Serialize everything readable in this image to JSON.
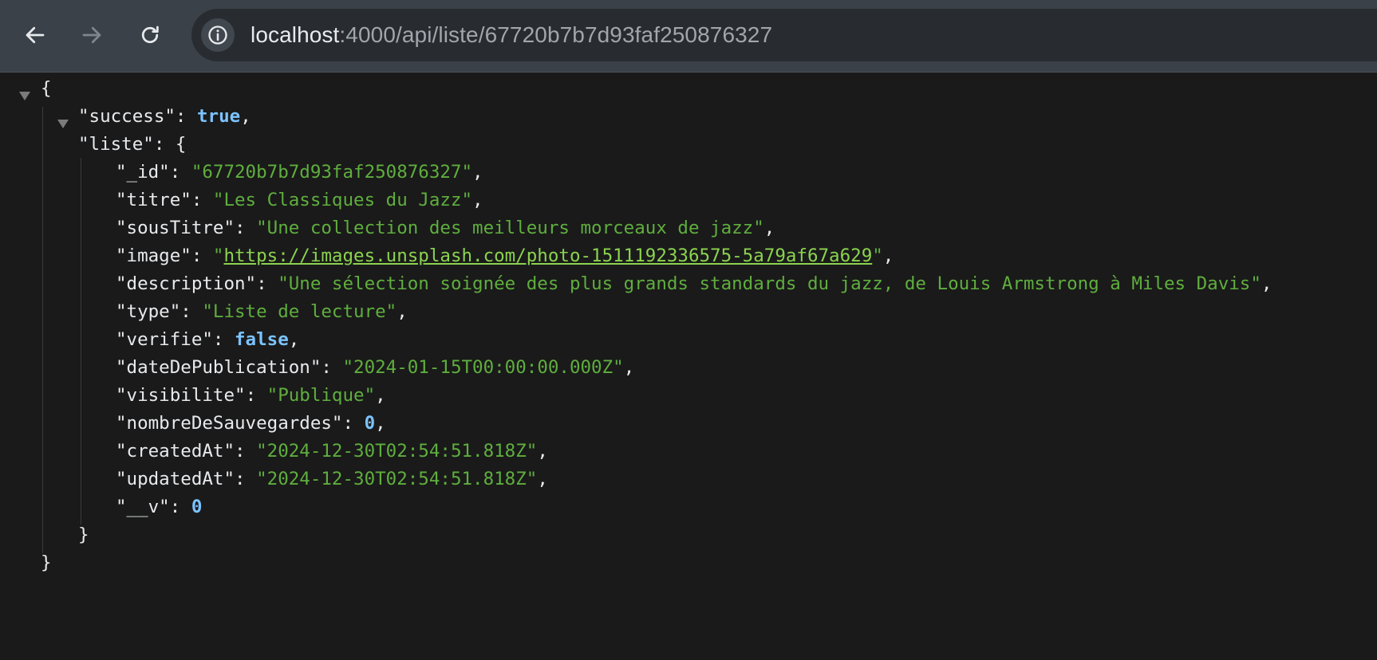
{
  "browser": {
    "url_host": "localhost",
    "url_path": ":4000/api/liste/67720b7b7d93faf250876327",
    "icons": {
      "back": "arrow-left-icon",
      "forward": "arrow-right-icon",
      "reload": "reload-icon",
      "site_info": "info-icon"
    }
  },
  "json": {
    "open_brace": "{",
    "close_brace": "}",
    "success_key": "\"success\"",
    "success_value": "true",
    "liste_key": "\"liste\"",
    "liste_open": "{",
    "liste_close": "}",
    "fields": [
      {
        "key": "\"_id\"",
        "value": "\"67720b7b7d93faf250876327\"",
        "kind": "str"
      },
      {
        "key": "\"titre\"",
        "value": "\"Les Classiques du Jazz\"",
        "kind": "str"
      },
      {
        "key": "\"sousTitre\"",
        "value": "\"Une collection des meilleurs morceaux de jazz\"",
        "kind": "str"
      },
      {
        "key": "\"image\"",
        "value": "https://images.unsplash.com/photo-1511192336575-5a79af67a629",
        "kind": "link"
      },
      {
        "key": "\"description\"",
        "value": "\"Une sélection soignée des plus grands standards du jazz, de Louis Armstrong à Miles Davis\"",
        "kind": "str"
      },
      {
        "key": "\"type\"",
        "value": "\"Liste de lecture\"",
        "kind": "str"
      },
      {
        "key": "\"verifie\"",
        "value": "false",
        "kind": "kw"
      },
      {
        "key": "\"dateDePublication\"",
        "value": "\"2024-01-15T00:00:00.000Z\"",
        "kind": "str"
      },
      {
        "key": "\"visibilite\"",
        "value": "\"Publique\"",
        "kind": "str"
      },
      {
        "key": "\"nombreDeSauvegardes\"",
        "value": "0",
        "kind": "num"
      },
      {
        "key": "\"createdAt\"",
        "value": "\"2024-12-30T02:54:51.818Z\"",
        "kind": "str"
      },
      {
        "key": "\"updatedAt\"",
        "value": "\"2024-12-30T02:54:51.818Z\"",
        "kind": "str"
      },
      {
        "key": "\"__v\"",
        "value": "0",
        "kind": "num"
      }
    ]
  },
  "colors": {
    "toolbar": "#3a4148",
    "page_bg": "#1a1a1a",
    "string": "#5fae3e",
    "keyword": "#7cc3ff"
  }
}
